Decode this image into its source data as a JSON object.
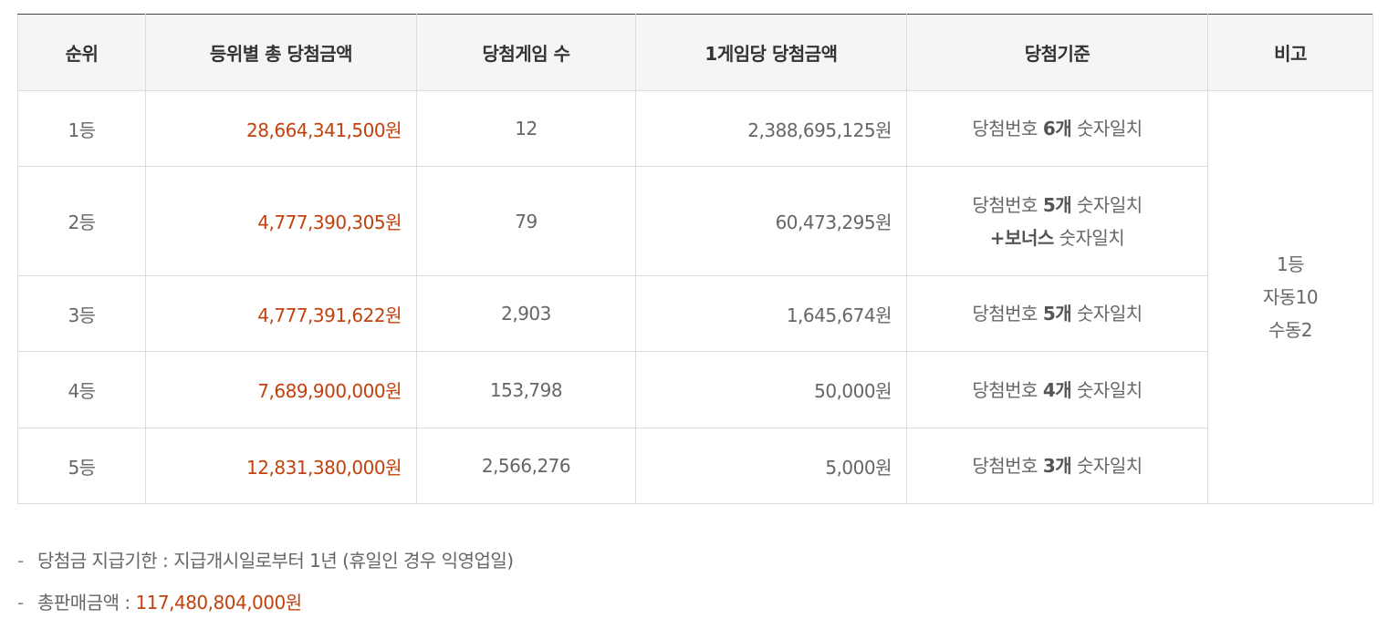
{
  "table": {
    "headers": [
      "순위",
      "등위별 총 당첨금액",
      "당첨게임 수",
      "1게임당 당첨금액",
      "당첨기준",
      "비고"
    ],
    "rows": [
      {
        "rank": "1등",
        "total": "28,664,341,500원",
        "games": "12",
        "per_game": "2,388,695,125원",
        "criteria_pre": "당첨번호 ",
        "criteria_bold": "6개",
        "criteria_post": " 숫자일치"
      },
      {
        "rank": "2등",
        "total": "4,777,390,305원",
        "games": "79",
        "per_game": "60,473,295원",
        "criteria_pre": "당첨번호 ",
        "criteria_bold": "5개",
        "criteria_post": " 숫자일치",
        "criteria2_bold": "+보너스",
        "criteria2_post": " 숫자일치"
      },
      {
        "rank": "3등",
        "total": "4,777,391,622원",
        "games": "2,903",
        "per_game": "1,645,674원",
        "criteria_pre": "당첨번호 ",
        "criteria_bold": "5개",
        "criteria_post": " 숫자일치"
      },
      {
        "rank": "4등",
        "total": "7,689,900,000원",
        "games": "153,798",
        "per_game": "50,000원",
        "criteria_pre": "당첨번호 ",
        "criteria_bold": "4개",
        "criteria_post": " 숫자일치"
      },
      {
        "rank": "5등",
        "total": "12,831,380,000원",
        "games": "2,566,276",
        "per_game": "5,000원",
        "criteria_pre": "당첨번호 ",
        "criteria_bold": "3개",
        "criteria_post": " 숫자일치"
      }
    ],
    "note": {
      "line1": "1등",
      "line2": "자동10",
      "line3": "수동2"
    }
  },
  "footnotes": {
    "dash": "-",
    "payout_label": "당첨금 지급기한 : 지급개시일로부터 1년 (휴일인 경우 익영업일)",
    "sales_label": "총판매금액 : ",
    "sales_value": "117,480,804,000원"
  },
  "colors": {
    "accent_red": "#c2410c",
    "header_bg": "#f5f5f5",
    "border": "#dcdcdc"
  }
}
